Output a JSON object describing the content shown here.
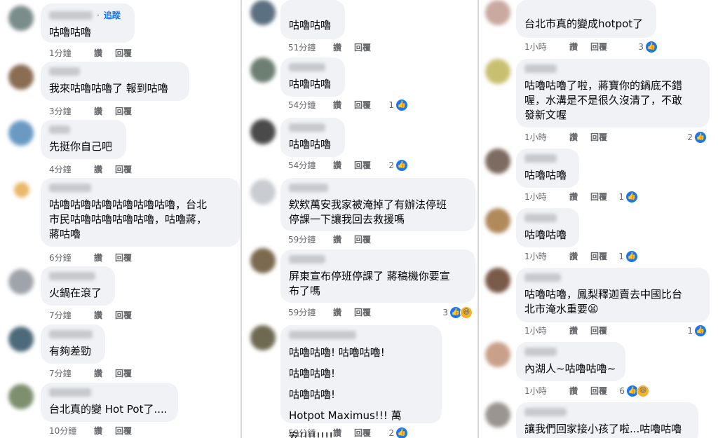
{
  "labels": {
    "like": "讚",
    "reply": "回覆",
    "follow": "追蹤"
  },
  "col1": [
    {
      "text": [
        "咕嚕咕嚕"
      ],
      "time": "1分鐘",
      "reactions": null
    },
    {
      "text": [
        "我來咕嚕咕嚕了 報到咕嚕"
      ],
      "time": "3分鐘",
      "reactions": null
    },
    {
      "text": [
        "先挺你自己吧"
      ],
      "time": "4分鐘",
      "reactions": null
    },
    {
      "text": [
        "咕嚕咕嚕咕嚕咕嚕咕嚕咕嚕，台北",
        "市民咕嚕咕嚕咕嚕咕嚕，咕嚕蔣，",
        "蔣咕嚕"
      ],
      "time": "6分鐘",
      "reactions": null
    },
    {
      "text": [
        "火鍋在滾了"
      ],
      "time": "7分鐘",
      "reactions": null
    },
    {
      "text": [
        "有夠差勁"
      ],
      "time": "7分鐘",
      "reactions": null
    },
    {
      "text": [
        "台北真的變 Hot Pot了...."
      ],
      "time": "10分鐘",
      "reactions": null
    }
  ],
  "col2": [
    {
      "text": [
        "咕嚕咕嚕"
      ],
      "time": "51分鐘",
      "reactions": null
    },
    {
      "text": [
        "咕嚕咕嚕"
      ],
      "time": "54分鐘",
      "reactions": "1"
    },
    {
      "text": [
        "咕嚕咕嚕"
      ],
      "time": "54分鐘",
      "reactions": "2"
    },
    {
      "text": [
        "欸欸萬安我家被淹掉了有辦法停班",
        "停課一下讓我回去救援嗎"
      ],
      "time": "59分鐘",
      "reactions": null
    },
    {
      "text": [
        "屏東宣布停班停課了 蔣稿機你要宣",
        "布了嗎"
      ],
      "time": "59分鐘",
      "reactions": "3"
    },
    {
      "text": [
        "咕嚕咕嚕! 咕嚕咕嚕!",
        "咕嚕咕嚕!",
        "咕嚕咕嚕!",
        "Hotpot Maximus!!! 萬安!!!!!!!!"
      ],
      "time": "59分鐘",
      "reactions": "2"
    }
  ],
  "col3": [
    {
      "text": [
        "台北市真的變成hotpot了"
      ],
      "time": "1小時",
      "reactions": "3"
    },
    {
      "text": [
        "咕嚕咕嚕了啦，蔣寶你的鍋底不錯",
        "喔，水溝是不是很久沒清了，不敢",
        "發新文喔"
      ],
      "time": "1小時",
      "reactions": "2"
    },
    {
      "text": [
        "咕嚕咕嚕"
      ],
      "time": "1小時",
      "reactions": "1"
    },
    {
      "text": [
        "咕嚕咕嚕"
      ],
      "time": "1小時",
      "reactions": "1"
    },
    {
      "text": [
        "咕嚕咕嚕，鳳梨釋迦賣去中國比台",
        "北市淹水重要😫"
      ],
      "time": "1小時",
      "reactions": "1"
    },
    {
      "text": [
        "內湖人~咕嚕咕嚕~"
      ],
      "time": "1小時",
      "reactions": "6"
    },
    {
      "text": [
        "讓我們回家接小孩了啦...咕嚕咕嚕"
      ],
      "time": "",
      "reactions": null
    }
  ]
}
